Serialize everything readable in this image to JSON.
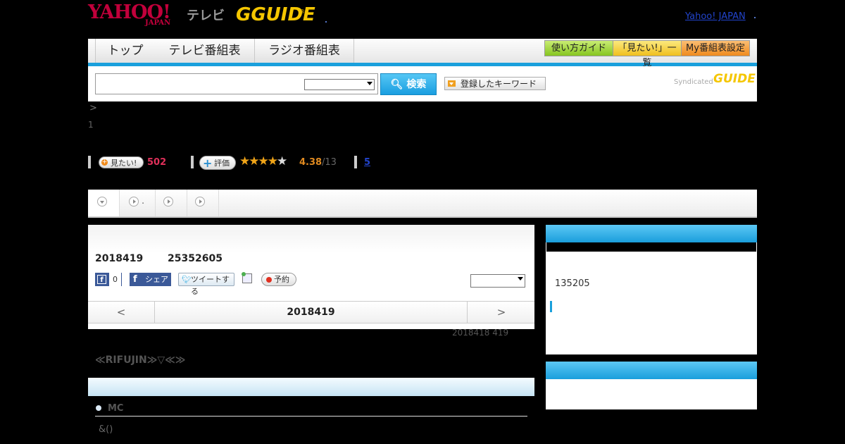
{
  "header": {
    "logo_yahoo": "YAHOO!",
    "logo_japan": "JAPAN",
    "logo_tv": "テレビ",
    "logo_gguide": "GGUIDE",
    "yahoo_japan_link": "Yahoo! JAPAN"
  },
  "nav": {
    "tabs": [
      {
        "label": "トップ"
      },
      {
        "label": "テレビ番組表"
      },
      {
        "label": "ラジオ番組表"
      }
    ],
    "buttons": {
      "guide": "使い方ガイド",
      "mitai_list": "「見たい!」一覧",
      "my_schedule": "My番組表設定"
    }
  },
  "search": {
    "input_value": "",
    "select_value": "",
    "button_label": "検索",
    "keyword_button": "登録したキーワード",
    "syndicated": "Syndicated",
    "gguide_mark": "GUIDE"
  },
  "breadcrumb": {
    "separator": ">",
    "page": "1"
  },
  "ratings": {
    "mitai_label": "見たい!",
    "mitai_count": "502",
    "hyoka_label": "評価",
    "stars_filled": "★★★★",
    "stars_empty": "★",
    "star_rating": 4.38,
    "score": "4.38",
    "score_count": "/13",
    "review_link": "5"
  },
  "tabstrip": {
    "tab2_suffix": "."
  },
  "program": {
    "date": "2018419",
    "time": "25352605",
    "fb_like_count": "0",
    "fb_share_label": "シェア",
    "tweet_label": "ツイートする",
    "reserve_label": "予約",
    "select_value": "",
    "day_nav": {
      "prev": "<",
      "current": "2018419",
      "next": ">"
    },
    "update_note": "2018418  419",
    "title": "≪RIFUJIN≫▽≪≫",
    "mc_label": "MC",
    "cast": "&()"
  },
  "sidebar": {
    "box1_text": "135205"
  },
  "colors": {
    "accent_blue": "#1aa0dc",
    "yahoo_red": "#c2003b",
    "gguide_yellow": "#f5c600",
    "mitai_pink": "#e0305a",
    "score_orange": "#e08a20"
  }
}
